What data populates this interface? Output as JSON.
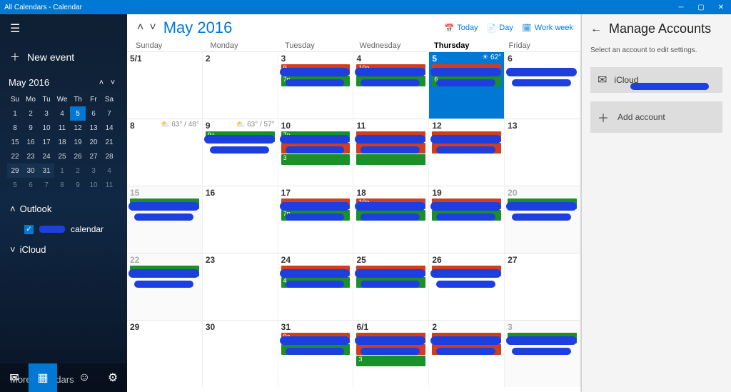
{
  "window": {
    "title": "All Calendars - Calendar"
  },
  "sidebar": {
    "new_event": "New event",
    "minical": {
      "month": "May 2016",
      "dow": [
        "Su",
        "Mo",
        "Tu",
        "We",
        "Th",
        "Fr",
        "Sa"
      ],
      "rows": [
        [
          {
            "n": "1"
          },
          {
            "n": "2"
          },
          {
            "n": "3"
          },
          {
            "n": "4"
          },
          {
            "n": "5",
            "today": true
          },
          {
            "n": "6"
          },
          {
            "n": "7"
          }
        ],
        [
          {
            "n": "8"
          },
          {
            "n": "9"
          },
          {
            "n": "10"
          },
          {
            "n": "11"
          },
          {
            "n": "12"
          },
          {
            "n": "13"
          },
          {
            "n": "14"
          }
        ],
        [
          {
            "n": "15"
          },
          {
            "n": "16"
          },
          {
            "n": "17"
          },
          {
            "n": "18"
          },
          {
            "n": "19"
          },
          {
            "n": "20"
          },
          {
            "n": "21"
          }
        ],
        [
          {
            "n": "22"
          },
          {
            "n": "23"
          },
          {
            "n": "24"
          },
          {
            "n": "25"
          },
          {
            "n": "26"
          },
          {
            "n": "27"
          },
          {
            "n": "28"
          }
        ],
        [
          {
            "n": "29",
            "sel": true
          },
          {
            "n": "30",
            "sel": true
          },
          {
            "n": "31",
            "sel": true
          },
          {
            "n": "1",
            "dim": true
          },
          {
            "n": "2",
            "dim": true
          },
          {
            "n": "3",
            "dim": true
          },
          {
            "n": "4",
            "dim": true
          }
        ],
        [
          {
            "n": "5",
            "dim": true
          },
          {
            "n": "6",
            "dim": true
          },
          {
            "n": "7",
            "dim": true
          },
          {
            "n": "8",
            "dim": true
          },
          {
            "n": "9",
            "dim": true
          },
          {
            "n": "10",
            "dim": true
          },
          {
            "n": "11",
            "dim": true
          }
        ]
      ]
    },
    "sections": [
      {
        "name": "Outlook",
        "expanded": true,
        "items": [
          {
            "label": "calendar",
            "checked": true,
            "redacted": true
          }
        ]
      },
      {
        "name": "iCloud",
        "expanded": false,
        "items": []
      }
    ],
    "more": "More calendars"
  },
  "header": {
    "title": "May 2016",
    "views": {
      "today": "Today",
      "day": "Day",
      "workweek": "Work week"
    },
    "days": [
      "Sunday",
      "Monday",
      "Tuesday",
      "Wednesday",
      "Thursday",
      "Friday"
    ]
  },
  "today_index": 4,
  "weeks": [
    {
      "days": [
        {
          "n": "5/1"
        },
        {
          "n": "2"
        },
        {
          "n": "3",
          "events": [
            {
              "c": "red",
              "t": "9"
            },
            {
              "c": "green",
              "t": "7p"
            }
          ],
          "scrib": true
        },
        {
          "n": "4",
          "events": [
            {
              "c": "red",
              "t": "10a"
            },
            {
              "c": "green",
              "t": ""
            }
          ],
          "scrib": true
        },
        {
          "n": "5",
          "today": true,
          "weather": "☀ 62°",
          "events": [
            {
              "c": "red",
              "t": ""
            },
            {
              "c": "green",
              "t": "6"
            }
          ],
          "scrib": true
        },
        {
          "n": "6",
          "scrib": true
        }
      ]
    },
    {
      "days": [
        {
          "n": "8",
          "weather": "⛅ 63° / 48°"
        },
        {
          "n": "9",
          "weather": "⛅ 63° / 57°",
          "events": [
            {
              "c": "green",
              "t": "9a"
            }
          ],
          "scrib": true
        },
        {
          "n": "10",
          "events": [
            {
              "c": "green",
              "t": "7p"
            },
            {
              "c": "red",
              "t": ""
            },
            {
              "c": "green",
              "t": "3"
            }
          ],
          "scrib": true
        },
        {
          "n": "11",
          "events": [
            {
              "c": "red",
              "t": ""
            },
            {
              "c": "red",
              "t": ""
            },
            {
              "c": "green",
              "t": ""
            }
          ],
          "scrib": true
        },
        {
          "n": "12",
          "events": [
            {
              "c": "red",
              "t": ""
            },
            {
              "c": "red",
              "t": ""
            }
          ],
          "scrib": true
        },
        {
          "n": "13"
        }
      ]
    },
    {
      "days": [
        {
          "n": "15",
          "dim": true,
          "events": [
            {
              "c": "green",
              "t": ""
            }
          ],
          "scrib": true
        },
        {
          "n": "16"
        },
        {
          "n": "17",
          "events": [
            {
              "c": "red",
              "t": ""
            },
            {
              "c": "green",
              "t": "7p"
            }
          ],
          "scrib": true
        },
        {
          "n": "18",
          "events": [
            {
              "c": "red",
              "t": "10a"
            },
            {
              "c": "green",
              "t": ""
            }
          ],
          "scrib": true
        },
        {
          "n": "19",
          "events": [
            {
              "c": "red",
              "t": ""
            },
            {
              "c": "green",
              "t": ""
            }
          ],
          "scrib": true
        },
        {
          "n": "20",
          "dim": true,
          "events": [
            {
              "c": "green",
              "t": ""
            }
          ],
          "scrib": true
        }
      ]
    },
    {
      "days": [
        {
          "n": "22",
          "dim": true,
          "events": [
            {
              "c": "green",
              "t": ""
            }
          ],
          "scrib": true
        },
        {
          "n": "23"
        },
        {
          "n": "24",
          "events": [
            {
              "c": "red",
              "t": ""
            },
            {
              "c": "green",
              "t": "4"
            }
          ],
          "scrib": true
        },
        {
          "n": "25",
          "events": [
            {
              "c": "red",
              "t": ""
            },
            {
              "c": "green",
              "t": ""
            }
          ],
          "scrib": true
        },
        {
          "n": "26",
          "events": [
            {
              "c": "red",
              "t": ""
            }
          ],
          "scrib": true
        },
        {
          "n": "27"
        }
      ]
    },
    {
      "days": [
        {
          "n": "29"
        },
        {
          "n": "30"
        },
        {
          "n": "31",
          "events": [
            {
              "c": "red",
              "t": "9a"
            },
            {
              "c": "green",
              "t": ""
            }
          ],
          "scrib": true
        },
        {
          "n": "6/1",
          "events": [
            {
              "c": "red",
              "t": ""
            },
            {
              "c": "red",
              "t": ""
            },
            {
              "c": "green",
              "t": "3"
            }
          ],
          "scrib": true
        },
        {
          "n": "2",
          "events": [
            {
              "c": "red",
              "t": ""
            },
            {
              "c": "red",
              "t": ""
            }
          ],
          "scrib": true
        },
        {
          "n": "3",
          "dim": true,
          "events": [
            {
              "c": "green",
              "t": ""
            }
          ],
          "scrib": true
        }
      ]
    }
  ],
  "pane": {
    "title": "Manage Accounts",
    "subtitle": "Select an account to edit settings.",
    "accounts": [
      {
        "name": "iCloud",
        "redacted": true
      }
    ],
    "add": "Add account"
  }
}
